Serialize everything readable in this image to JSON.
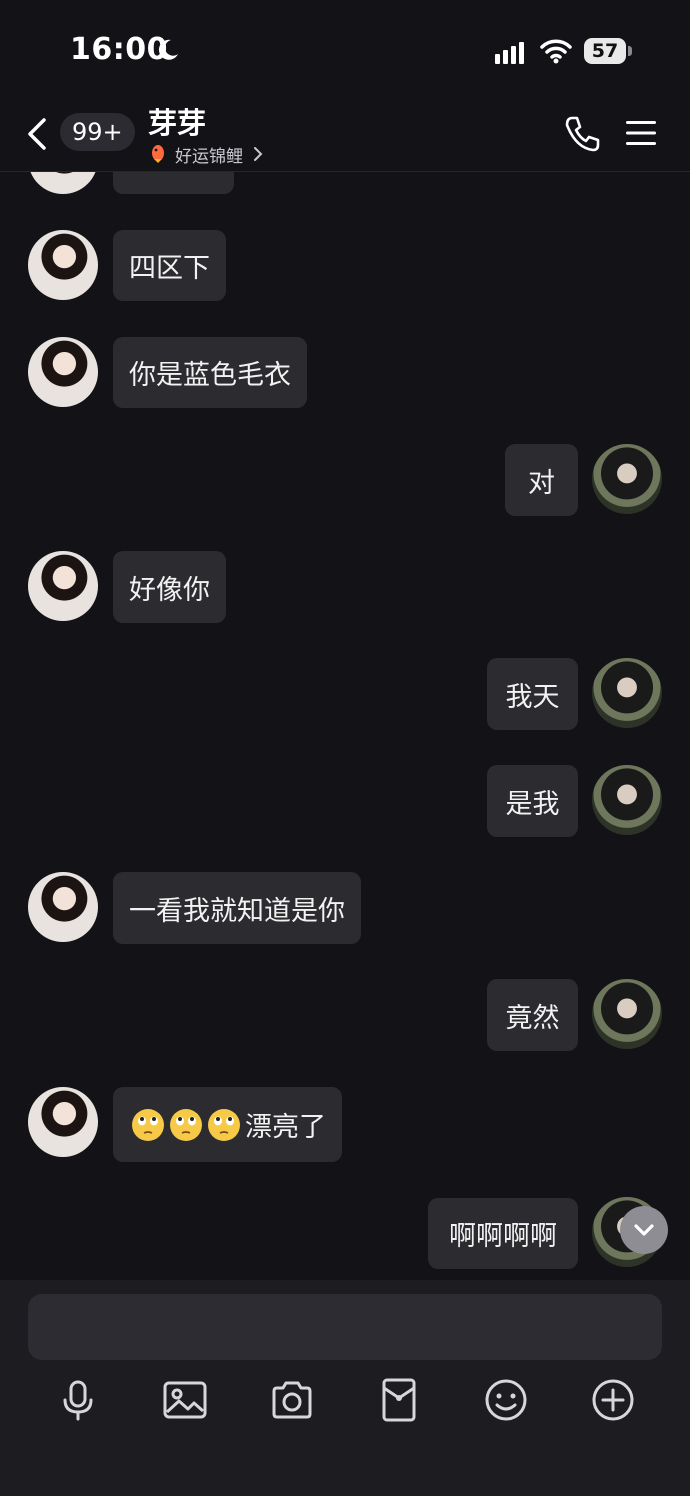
{
  "status": {
    "time": "16:00",
    "battery": "57"
  },
  "header": {
    "unread": "99+",
    "name": "芽芽",
    "subtitle": "好运锦鲤"
  },
  "messages": [
    {
      "side": "left",
      "text": "四区下"
    },
    {
      "side": "left",
      "text": "你是蓝色毛衣"
    },
    {
      "side": "right",
      "text": "对"
    },
    {
      "side": "left",
      "text": "好像你"
    },
    {
      "side": "right",
      "text": "我天"
    },
    {
      "side": "right",
      "text": "是我"
    },
    {
      "side": "left",
      "text": "一看我就知道是你"
    },
    {
      "side": "right",
      "text": "竟然"
    },
    {
      "side": "left",
      "text": "漂亮了",
      "emojis": 3
    },
    {
      "side": "right",
      "text": "啊啊啊啊"
    }
  ],
  "toolbar": [
    "microphone-icon",
    "image-icon",
    "camera-icon",
    "red-packet-icon",
    "emoji-icon",
    "plus-icon"
  ]
}
